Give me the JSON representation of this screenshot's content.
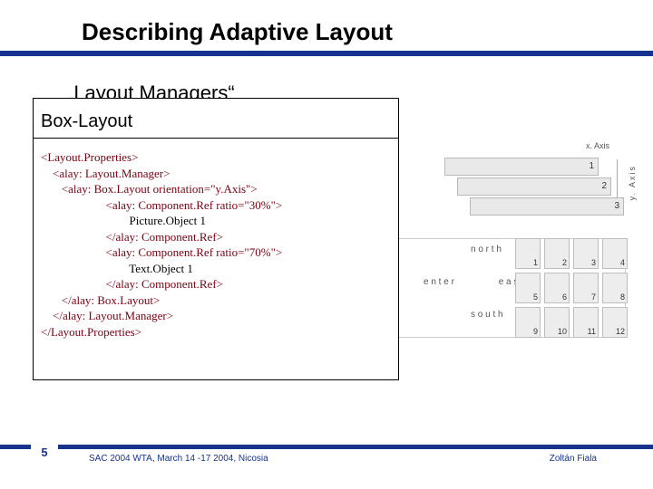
{
  "title": "Describing Adaptive Layout",
  "subtitle": "„Layout Managers“",
  "codebox": {
    "heading": "Box-Layout",
    "lines": [
      "<Layout.Properties>",
      "    <alay: Layout.Manager>",
      "       <alay: Box.Layout orientation=\"y.Axis\">",
      "                      <alay: Component.Ref ratio=\"30%\">",
      "                              Picture.Object 1",
      "                      </alay: Component.Ref>",
      "                      <alay: Component.Ref ratio=\"70%\">",
      "                              Text.Object 1",
      "                      </alay: Component.Ref>",
      "       </alay: Box.Layout>",
      "    </alay: Layout.Manager>",
      "</Layout.Properties>"
    ]
  },
  "diagrams": {
    "xaxis": "x. Axis",
    "yaxis": "y. Axis",
    "rows": [
      "1",
      "2",
      "3"
    ],
    "border": {
      "north": "n o r t h",
      "center": "e n t e r",
      "east": "e a s t",
      "south": "s o u t h"
    },
    "grid": [
      "1",
      "2",
      "3",
      "4",
      "5",
      "6",
      "7",
      "8",
      "9",
      "10",
      "11",
      "12"
    ]
  },
  "footer": {
    "page": "5",
    "left": "SAC 2004 WTA, March 14 -17 2004, Nicosia",
    "right": "Zoltán Fiala"
  }
}
